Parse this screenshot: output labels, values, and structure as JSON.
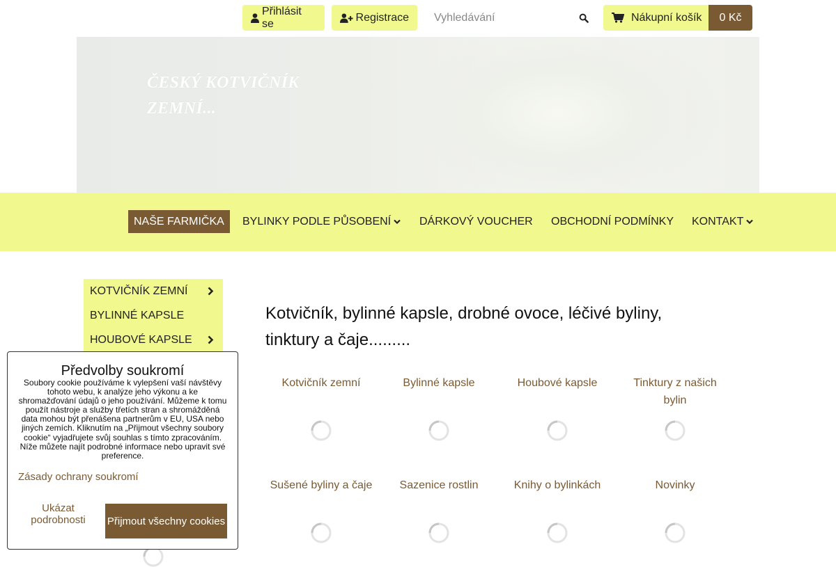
{
  "colors": {
    "accent_yellow": "#f1f88d",
    "brand_brown": "#7a5a33"
  },
  "header": {
    "login_label": "Přihlásit se",
    "register_label": "Registrace",
    "search_placeholder": "Vyhledávání",
    "cart_label": "Nákupní košík",
    "cart_total": "0 Kč",
    "icons": [
      "user-icon",
      "user-plus-icon",
      "search-icon",
      "shopping-cart-icon"
    ]
  },
  "hero": {
    "title_line1": "ČESKÝ KOTVIČNÍK",
    "title_line2": "ZEMNÍ..."
  },
  "nav": {
    "items": [
      {
        "label": "NAŠE FARMIČKA",
        "active": true
      },
      {
        "label": "BYLINKY PODLE PŮSOBENÍ",
        "dropdown": true
      },
      {
        "label": "DÁRKOVÝ VOUCHER"
      },
      {
        "label": "OBCHODNÍ PODMÍNKY"
      },
      {
        "label": "KONTAKT",
        "dropdown": true
      }
    ]
  },
  "sidebar": {
    "items": [
      {
        "label": "KOTVIČNÍK ZEMNÍ",
        "has_submenu": true
      },
      {
        "label": "BYLINNÉ KAPSLE",
        "has_submenu": false
      },
      {
        "label": "HOUBOVÉ KAPSLE",
        "has_submenu": true
      }
    ]
  },
  "main": {
    "title": "Kotvičník, bylinné kapsle, drobné ovoce, léčivé byliny, tinktury a čaje.........",
    "categories": [
      {
        "label": "Kotvičník zemní"
      },
      {
        "label": "Bylinné kapsle"
      },
      {
        "label": "Houbové kapsle"
      },
      {
        "label": "Tinktury z našich bylin"
      },
      {
        "label": "Sušené byliny a čaje"
      },
      {
        "label": "Sazenice rostlin"
      },
      {
        "label": "Knihy o bylinkách"
      },
      {
        "label": "Novinky"
      }
    ]
  },
  "cookie": {
    "title": "Předvolby soukromí",
    "text": "Soubory cookie používáme k vylepšení vaší návštěvy tohoto webu, k analýze jeho výkonu a ke shromažďování údajů o jeho používání. Můžeme k tomu použít nástroje a služby třetích stran a shromážděná data mohou být přenášena partnerům v EU, USA nebo jiných zemích. Kliknutím na „Přijmout všechny soubory cookie“ vyjadřujete svůj souhlas s tímto zpracováním. Níže můžete najít podrobné informace nebo upravit své preference.",
    "privacy_link": "Zásady ochrany soukromí",
    "details_label": "Ukázat podrobnosti",
    "accept_label": "Přijmout všechny cookies"
  }
}
